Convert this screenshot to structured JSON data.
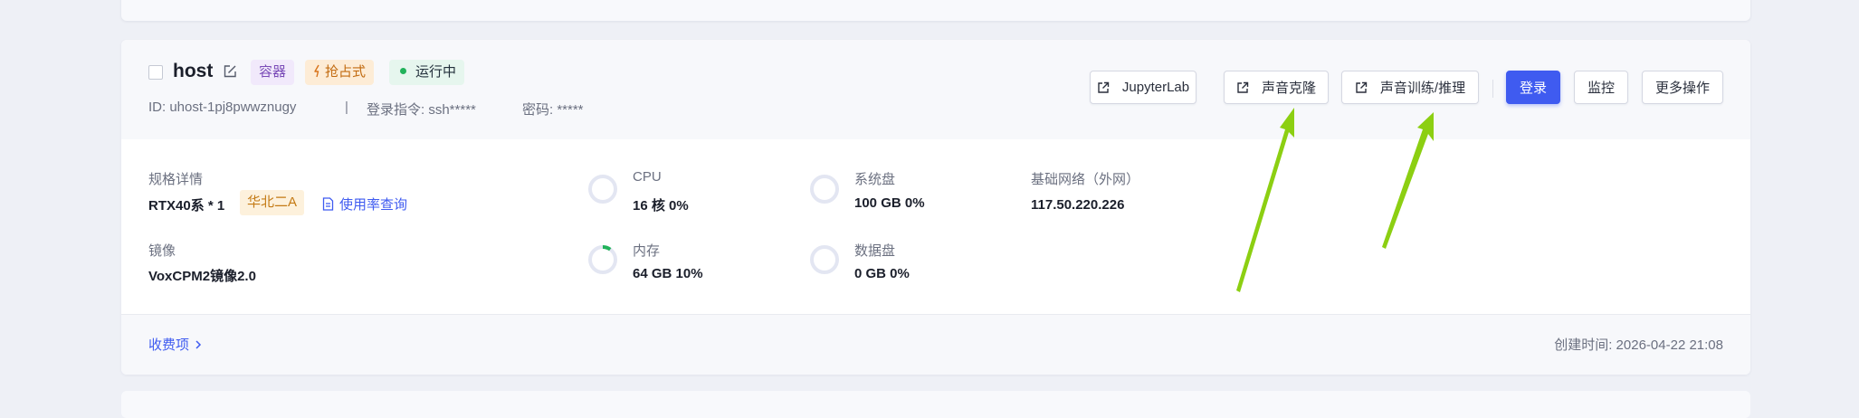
{
  "instance": {
    "name": "host",
    "tags": {
      "container": "容器",
      "preemptible": "抢占式",
      "status": "运行中"
    },
    "id": "ID: uhost-1pj8pwwznugy",
    "separator": "|",
    "login_cmd": "登录指令: ssh*****",
    "password": "密码: *****"
  },
  "actions": {
    "jupyter": "JupyterLab",
    "voice_clone": "声音克隆",
    "voice_train": "声音训练/推理",
    "login": "登录",
    "monitor": "监控",
    "more": "更多操作"
  },
  "specs": {
    "spec_label": "规格详情",
    "spec_value": "RTX40系 * 1",
    "region": "华北二A",
    "usage_link": "使用率查询",
    "image_label": "镜像",
    "image_value": "VoxCPM2镜像2.0",
    "cpu_label": "CPU",
    "cpu_value": "16 核 0%",
    "cpu_usage": 0,
    "mem_label": "内存",
    "mem_value": "64 GB 10%",
    "mem_usage": 0.1,
    "sys_disk_label": "系统盘",
    "sys_disk_value": "100 GB 0%",
    "sys_disk_usage": 0,
    "data_disk_label": "数据盘",
    "data_disk_value": "0 GB 0%",
    "data_disk_usage": 0,
    "network_label": "基础网络（外网）",
    "network_value": "117.50.220.226"
  },
  "footer": {
    "charges_link": "收费项",
    "created": "创建时间: 2026-04-22 21:08"
  },
  "colors": {
    "primary": "#3f5bf0",
    "ring_track": "#e3e6f2",
    "ring_fill": "#21b25a",
    "arrow": "#8ccf12"
  }
}
